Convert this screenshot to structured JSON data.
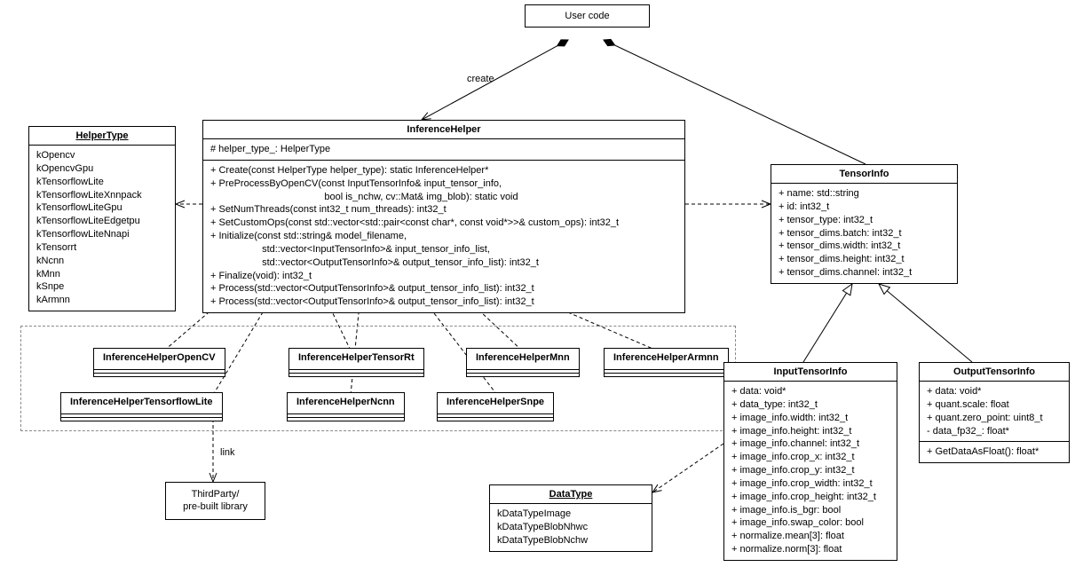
{
  "userCode": {
    "title": "User code"
  },
  "labels": {
    "create": "create",
    "link": "link"
  },
  "helperType": {
    "title": "HelperType",
    "items": [
      "kOpencv",
      "kOpencvGpu",
      "kTensorflowLite",
      "kTensorflowLiteXnnpack",
      "kTensorflowLiteGpu",
      "kTensorflowLiteEdgetpu",
      "kTensorflowLiteNnapi",
      "kTensorrt",
      "kNcnn",
      "kMnn",
      "kSnpe",
      "kArmnn"
    ]
  },
  "inferenceHelper": {
    "title": "InferenceHelper",
    "attrs": [
      "# helper_type_: HelperType"
    ],
    "ops": [
      "+ Create(const HelperType helper_type): static InferenceHelper*",
      "+ PreProcessByOpenCV(const InputTensorInfo& input_tensor_info,",
      "                                          bool is_nchw, cv::Mat& img_blob): static void",
      "+ SetNumThreads(const int32_t num_threads): int32_t",
      "+ SetCustomOps(const std::vector<std::pair<const char*, const void*>>& custom_ops): int32_t",
      "+ Initialize(const std::string& model_filename,",
      "                   std::vector<InputTensorInfo>& input_tensor_info_list,",
      "                   std::vector<OutputTensorInfo>& output_tensor_info_list): int32_t",
      "+ Finalize(void): int32_t",
      "+ Process(std::vector<OutputTensorInfo>& output_tensor_info_list): int32_t",
      "+ Process(std::vector<OutputTensorInfo>& output_tensor_info_list): int32_t"
    ]
  },
  "tensorInfo": {
    "title": "TensorInfo",
    "attrs": [
      "+ name: std::string",
      "+ id: int32_t",
      "+ tensor_type: int32_t",
      "+ tensor_dims.batch: int32_t",
      "+ tensor_dims.width: int32_t",
      "+ tensor_dims.height: int32_t",
      "+ tensor_dims.channel: int32_t"
    ]
  },
  "subclasses": {
    "opencv": "InferenceHelperOpenCV",
    "tensorrt": "InferenceHelperTensorRt",
    "mnn": "InferenceHelperMnn",
    "armnn": "InferenceHelperArmnn",
    "tflite": "InferenceHelperTensorflowLite",
    "ncnn": "InferenceHelperNcnn",
    "snpe": "InferenceHelperSnpe"
  },
  "thirdParty": {
    "line1": "ThirdParty/",
    "line2": "pre-built library"
  },
  "dataType": {
    "title": "DataType",
    "items": [
      "kDataTypeImage",
      "kDataTypeBlobNhwc",
      "kDataTypeBlobNchw"
    ]
  },
  "inputTensorInfo": {
    "title": "InputTensorInfo",
    "attrs": [
      "+ data: void*",
      "+ data_type: int32_t",
      "+ image_info.width: int32_t",
      "+ image_info.height: int32_t",
      "+ image_info.channel: int32_t",
      "+ image_info.crop_x: int32_t",
      "+ image_info.crop_y: int32_t",
      "+ image_info.crop_width: int32_t",
      "+ image_info.crop_height: int32_t",
      "+ image_info.is_bgr: bool",
      "+ image_info.swap_color: bool",
      "+ normalize.mean[3]: float",
      "+ normalize.norm[3]: float"
    ]
  },
  "outputTensorInfo": {
    "title": "OutputTensorInfo",
    "attrs": [
      "+ data: void*",
      "+ quant.scale: float",
      "+ quant.zero_point: uint8_t",
      "- data_fp32_: float*"
    ],
    "ops": [
      "+ GetDataAsFloat(): float*"
    ]
  }
}
